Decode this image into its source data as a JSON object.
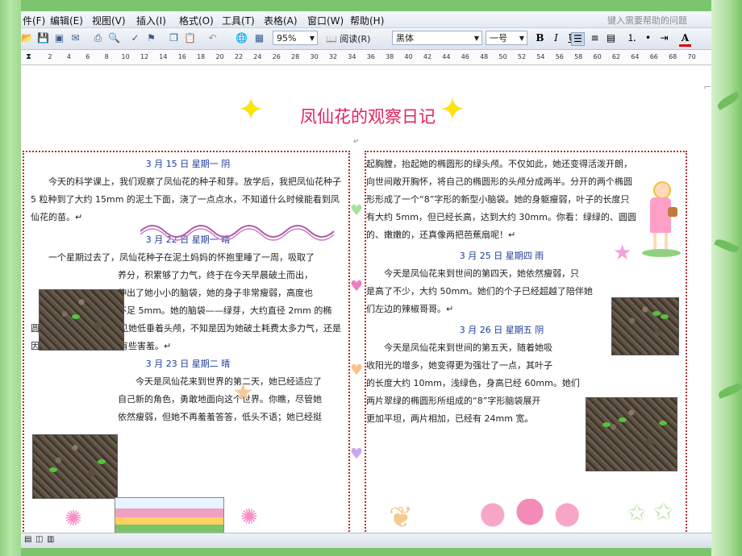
{
  "menu": {
    "items": [
      "件(F)",
      "编辑(E)",
      "视图(V)",
      "插入(I)",
      "格式(O)",
      "工具(T)",
      "表格(A)",
      "窗口(W)",
      "帮助(H)"
    ],
    "help_placeholder": "键入需要帮助的问题"
  },
  "toolbar": {
    "zoom": "95%",
    "read_label": "阅读(R)",
    "font": "黑体",
    "size": "一号",
    "bold": "B",
    "italic": "I",
    "underline": "U",
    "font_color_label": "A"
  },
  "ruler": {
    "ticks": [
      "2",
      "4",
      "6",
      "8",
      "10",
      "12",
      "14",
      "16",
      "18",
      "20",
      "22",
      "24",
      "26",
      "28",
      "30",
      "32",
      "34",
      "36",
      "38",
      "40",
      "42",
      "44",
      "46",
      "48",
      "50",
      "52",
      "54",
      "56",
      "58",
      "60",
      "62",
      "64",
      "66",
      "68",
      "70"
    ]
  },
  "doc": {
    "title": "凤仙花的观察日记",
    "left": {
      "d1": "3 月 15 日    星期一    阴",
      "p1": "今天的科学课上，我们观察了凤仙花的种子和芽。放学后，我把凤仙花种子 5 粒种到了大约 15mm 的泥土下面，浇了一点点水，不知道什么时候能看到凤仙花的苗。↵",
      "d2": "3 月 22 日    星期一      晴",
      "p2a": "一个星期过去了，凤仙花种子在泥土妈妈的怀抱里睡了一周，吸取了",
      "p2b": "养分，积累够了力气，终于在今天早晨破土而出，",
      "p2c": "伸出了她小小的脑袋，她的身子非常瘦弱，高度也",
      "p2d": "不足 5mm。她的脑袋——绿芽，大约直径 2mm 的椭",
      "p2e": "圆，非常精细好看。只见她低垂着头颅，不知是因为她破土耗费太多力气，还是因为刚刚来到这个世界有些害羞。↵",
      "d3": "3 月 23 日    星期二     晴",
      "p3a": "今天是凤仙花来到世界的第二天，她已经适应了",
      "p3b": "自己新的角色，勇敢地面向这个世界。你瞧，尽管她",
      "p3c": "依然瘦弱，但她不再羞羞答答，低头不语；她已经挺"
    },
    "right": {
      "p0": "起胸膛，抬起她的椭圆形的绿头颅。不仅如此，她还变得活泼开朗，向世间敞开胸怀，将自己的椭圆形的头颅分成两半。分开的两个椭圆形形成了一个“8”字形的新型小脑袋。她的身躯瘦弱，叶子的长度只有大约 5mm，但已经长高，达到大约 30mm。你看：绿绿的、圆圆的、嫩嫩的，还真像两把芭蕉扇呢！↵",
      "d4": "3 月 25 日    星期四    雨",
      "p4a": "今天是凤仙花来到世间的第四天，她依然瘦弱，只",
      "p4b": "是高了不少，大约 50mm。她们的个子已经超越了陪伴她",
      "p4c": "们左边的辣椒哥哥。↵",
      "d5": "3 月 26 日    星期五    阴",
      "p5a": "今天是凤仙花来到世间的第五天，随着她吸",
      "p5b": "收阳光的增多，她变得更为强壮了一点，其叶子",
      "p5c": "的长度大约 10mm，浅绿色，身高已经 60mm。她们",
      "p5d": "两片翠绿的椭圆形所组成的“8”字形脑袋展开",
      "p5e": "更加平坦，两片相加，已经有 24mm 宽。"
    }
  }
}
